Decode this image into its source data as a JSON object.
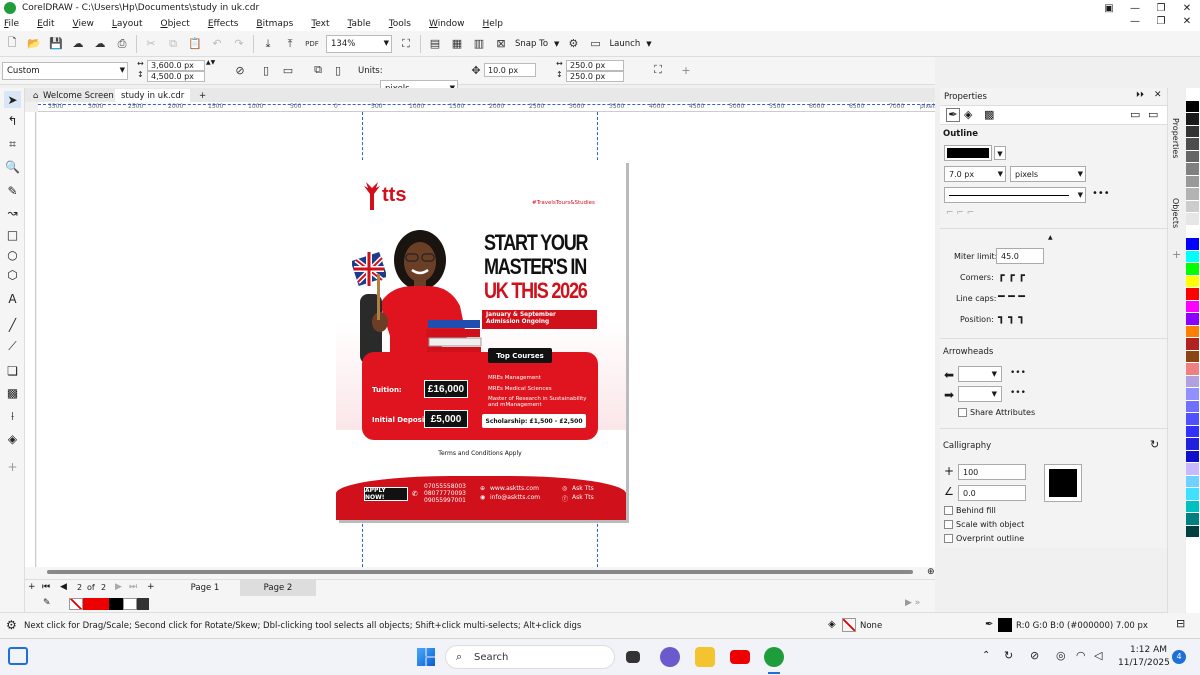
{
  "app": {
    "title": "CorelDRAW - C:\\Users\\Hp\\Documents\\study in uk.cdr"
  },
  "menu": [
    "File",
    "Edit",
    "View",
    "Layout",
    "Object",
    "Effects",
    "Bitmaps",
    "Text",
    "Table",
    "Tools",
    "Window",
    "Help"
  ],
  "toolbar": {
    "zoom": "134%",
    "snap_to": "Snap To",
    "launch": "Launch",
    "pdf": "PDF"
  },
  "propbar": {
    "preset": "Custom",
    "width": "3,600.0 px",
    "height": "4,500.0 px",
    "units_label": "Units:",
    "units": "pixels",
    "nudge": "10.0 px",
    "dup_x": "250.0 px",
    "dup_y": "250.0 px"
  },
  "doc_tabs": {
    "welcome": "Welcome Screen",
    "file": "study in uk.cdr"
  },
  "ruler": {
    "labels": [
      "3500",
      "3000",
      "2500",
      "2000",
      "1500",
      "1000",
      "500",
      "0",
      "500",
      "1000",
      "1500",
      "2000",
      "2500",
      "3000",
      "3500",
      "4000",
      "4500",
      "5000",
      "5500",
      "6000",
      "6500",
      "7000"
    ],
    "unit": "pixels"
  },
  "flyer": {
    "logo": "tts",
    "hashtag": "#TravelsTours&Studies",
    "headline1": "START YOUR",
    "headline2": "MASTER'S IN",
    "headline3": "UK THIS 2026",
    "admission": "January & September Admission Ongoing",
    "top_courses": "Top Courses",
    "tuition_label": "Tuition:",
    "tuition_value": "£16,000",
    "deposit_label": "Initial Deposit:",
    "deposit_value": "£5,000",
    "courses": [
      "MREs Management",
      "MREs Medical Sciences",
      "Master of Research in Sustainability and mManagement"
    ],
    "scholarship": "Scholarship: £1,500 - £2,500",
    "terms": "Terms and Conditions Apply",
    "apply": "APPLY NOW!",
    "phones": [
      "07055558003",
      "08077770093",
      "09055997001"
    ],
    "web": "www.asktts.com",
    "email": "info@asktts.com",
    "social1": "Ask Tts",
    "social2": "Ask Tts"
  },
  "pages": {
    "current": "2",
    "of": "of",
    "total": "2",
    "page1": "Page 1",
    "page2": "Page 2"
  },
  "status": {
    "hint": "Next click for Drag/Scale; Second click for Rotate/Skew; Dbl-clicking tool selects all objects; Shift+click multi-selects; Alt+click digs",
    "fill": "None",
    "outline": "R:0 G:0 B:0 (#000000)  7.00 px"
  },
  "docker": {
    "title": "Properties",
    "outline": "Outline",
    "width": "7.0 px",
    "units": "pixels",
    "miter_label": "Miter limit:",
    "miter": "45.0",
    "corners": "Corners:",
    "caps": "Line caps:",
    "position": "Position:",
    "arrowheads": "Arrowheads",
    "share": "Share Attributes",
    "calligraphy": "Calligraphy",
    "stretch": "100",
    "angle": "0.0",
    "behind_fill": "Behind fill",
    "scale": "Scale with object",
    "overprint": "Overprint outline",
    "tab_properties": "Properties",
    "tab_objects": "Objects"
  },
  "palette": [
    "#ffffff",
    "#000000",
    "#1a1a1a",
    "#333333",
    "#4d4d4d",
    "#666666",
    "#808080",
    "#999999",
    "#b3b3b3",
    "#cccccc",
    "#e6e6e6",
    "#ffffff",
    "#0000ff",
    "#00ffff",
    "#00ff00",
    "#ffff00",
    "#ff0000",
    "#ff00ff",
    "#8b00ff",
    "#ff8000",
    "#b22222",
    "#8b4513",
    "#f08080",
    "#b0a0e0",
    "#9090ff",
    "#7070ff",
    "#5050ff",
    "#3030ff",
    "#2020dd",
    "#1010cc",
    "#c8b8ff",
    "#70d0ff",
    "#40e0ff",
    "#00c0c0",
    "#008080",
    "#004040"
  ],
  "taskbar": {
    "search": "Search",
    "time": "1:12 AM",
    "date": "11/17/2025",
    "badge": "4"
  }
}
